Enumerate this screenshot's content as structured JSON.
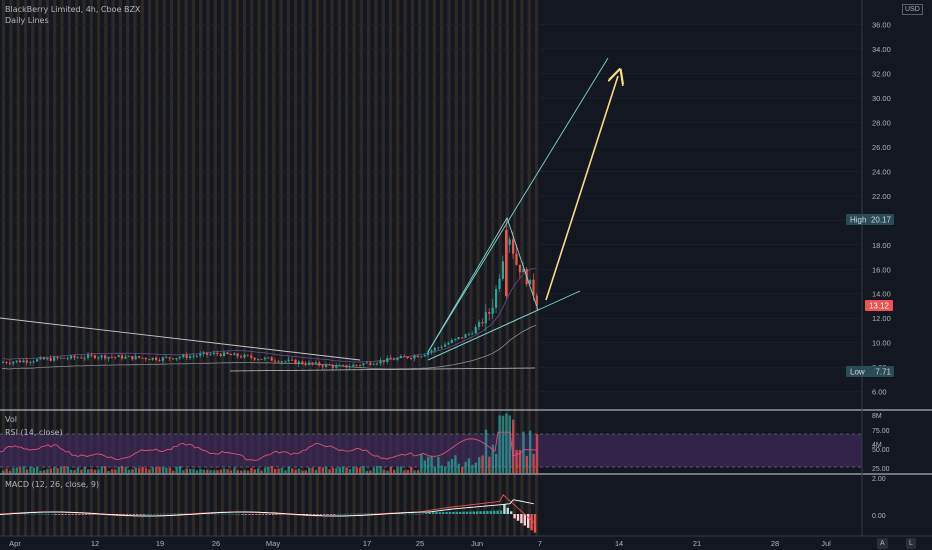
{
  "header": {
    "title": "BlackBerry Limited, 4h, Cboe BZX",
    "subtitle": "Daily Lines",
    "currency": "USD"
  },
  "chart_data": {
    "type": "candlestick",
    "price_axis": {
      "ticks": [
        "6.00",
        "8.00",
        "10.00",
        "12.00",
        "14.00",
        "16.00",
        "18.00",
        "20.00",
        "22.00",
        "24.00",
        "26.00",
        "28.00",
        "30.00",
        "32.00",
        "34.00",
        "36.00"
      ],
      "ylim": [
        4.5,
        38
      ],
      "last_price": "13.12",
      "high_label": "High",
      "high_value": "20.17",
      "low_label": "Low",
      "low_value": "7.71"
    },
    "time_axis": {
      "labels": [
        "Apr",
        "12",
        "19",
        "26",
        "May",
        "17",
        "25",
        "Jun",
        "7",
        "14",
        "21",
        "28",
        "Jul"
      ],
      "scale_button": "A",
      "log_button": "L"
    },
    "candles_approx": [
      {
        "t": "Apr",
        "close": 8.4
      },
      {
        "t": "12",
        "close": 8.9
      },
      {
        "t": "19",
        "close": 8.7
      },
      {
        "t": "26",
        "close": 9.1
      },
      {
        "t": "May",
        "close": 8.6
      },
      {
        "t": "17",
        "close": 8.0
      },
      {
        "t": "25",
        "close": 9.0
      },
      {
        "t": "Jun",
        "close": 12.6
      },
      {
        "t": "peak",
        "close": 20.17
      },
      {
        "t": "7",
        "close": 13.12
      }
    ],
    "volume_pane": {
      "label": "Vol",
      "axis_ticks": [
        "8M",
        "4M"
      ]
    },
    "rsi_pane": {
      "label": "RSI (14, close)",
      "levels": [
        "75.00",
        "50.00",
        "25.00"
      ]
    },
    "macd_pane": {
      "label": "MACD (12, 26, close, 9)",
      "axis_ticks": [
        "2.00",
        "0.00"
      ]
    },
    "colors": {
      "background": "#131722",
      "up": "#26a69a",
      "down": "#ef5350",
      "trendline": "#7fd6cf",
      "arrow": "#f7dc82",
      "pane_divider": "#d1d4dc",
      "rsi_band": "#3d2a57",
      "macd_line": "#ef5350",
      "signal_line": "#ffffff",
      "vertical_stripe": "#7a5a2a"
    }
  }
}
